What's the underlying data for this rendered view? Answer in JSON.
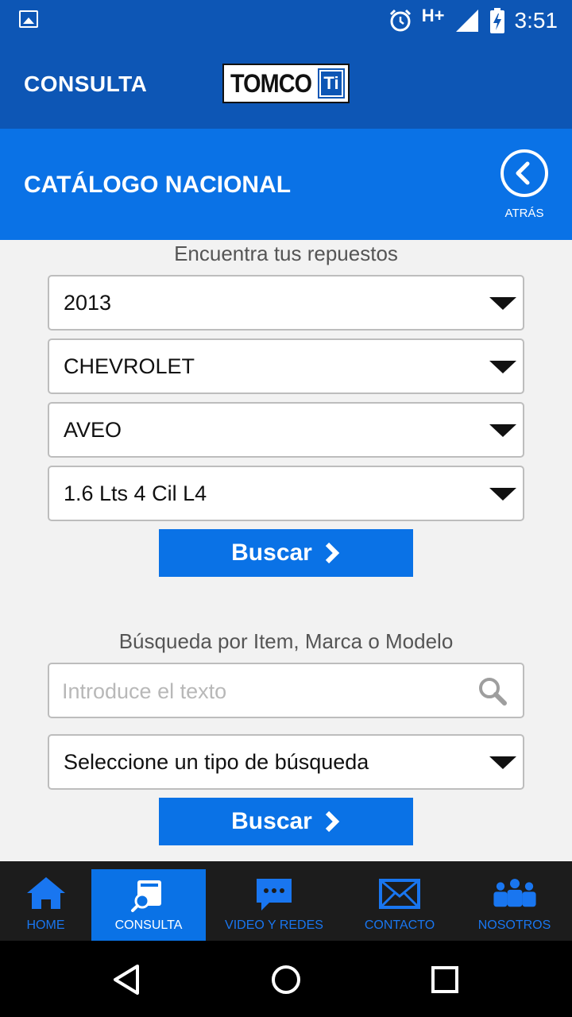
{
  "status_bar": {
    "network": "H+",
    "time": "3:51"
  },
  "app_bar": {
    "title": "CONSULTA",
    "logo_text": "TOMCO",
    "logo_badge": "Ti"
  },
  "section": {
    "title": "CATÁLOGO NACIONAL",
    "back_label": "ATRÁS"
  },
  "vehicle_search": {
    "caption": "Encuentra tus repuestos",
    "year": "2013",
    "make": "CHEVROLET",
    "model": "AVEO",
    "engine": "1.6 Lts 4 Cil L4",
    "button_label": "Buscar"
  },
  "text_search": {
    "caption": "Búsqueda por Item, Marca o Modelo",
    "placeholder": "Introduce el texto",
    "type_select": "Seleccione un tipo de búsqueda",
    "button_label": "Buscar"
  },
  "bottom_nav": {
    "items": [
      {
        "label": "HOME",
        "icon": "home-icon"
      },
      {
        "label": "CONSULTA",
        "icon": "catalog-search-icon",
        "active": true
      },
      {
        "label": "VIDEO Y REDES",
        "icon": "chat-icon"
      },
      {
        "label": "CONTACTO",
        "icon": "mail-icon"
      },
      {
        "label": "NOSOTROS",
        "icon": "people-icon"
      }
    ]
  },
  "colors": {
    "primary_dark": "#0d56b5",
    "primary": "#0a72e6",
    "nav_bg": "#1c1c1c"
  }
}
